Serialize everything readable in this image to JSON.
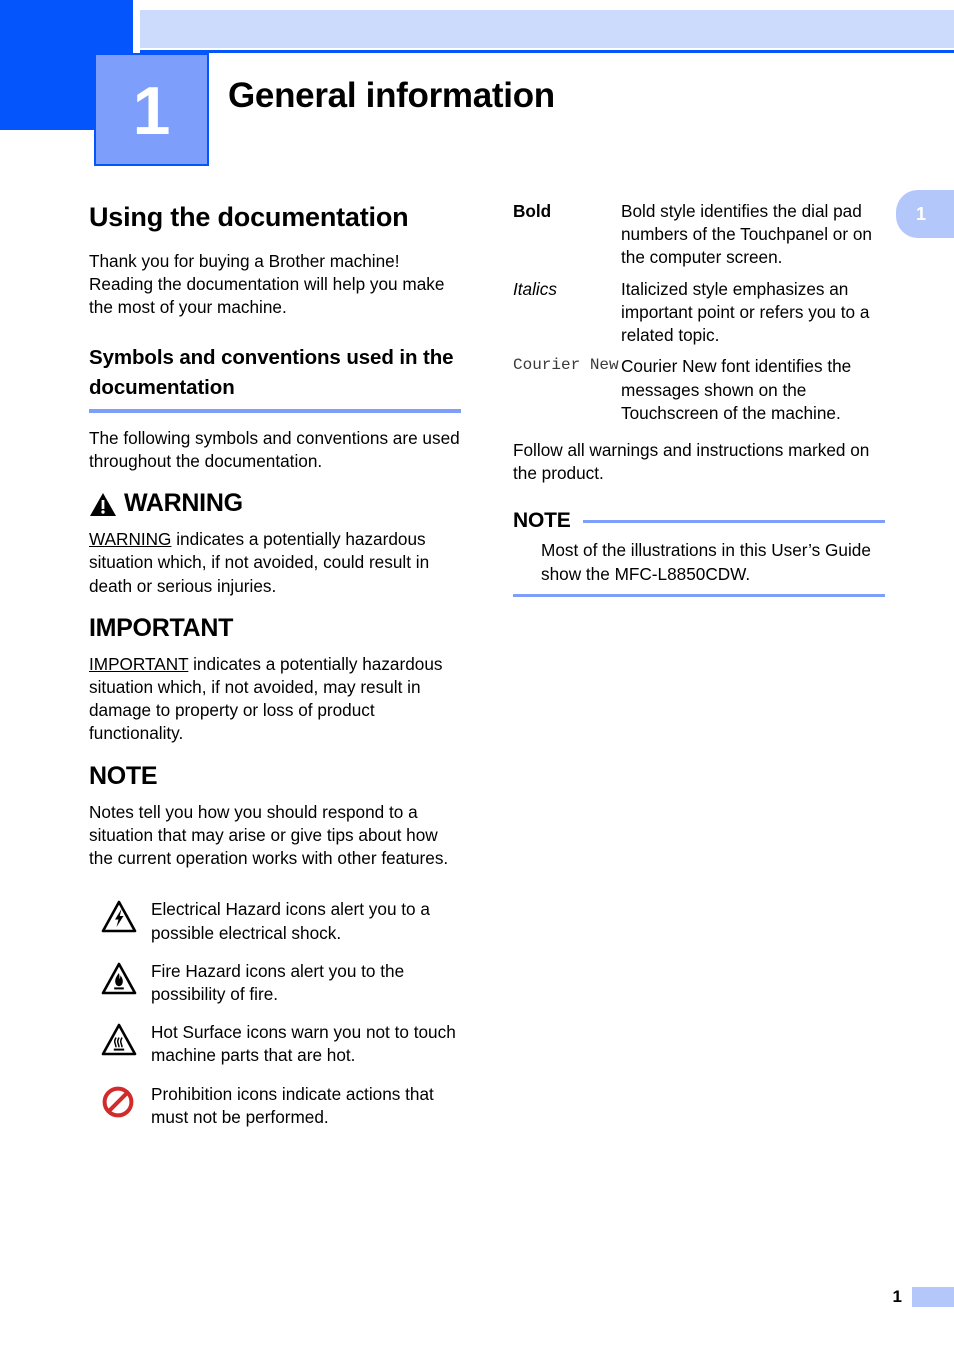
{
  "chapter": {
    "number": "1",
    "title": "General information",
    "side_tab_number": "1"
  },
  "left_column": {
    "section_title": "Using the documentation",
    "intro_paragraph": "Thank you for buying a Brother machine! Reading the documentation will help you make the most of your machine.",
    "subsection_title": "Symbols and conventions used in the documentation",
    "subsection_intro": "The following symbols and conventions are used throughout the documentation.",
    "alerts": [
      {
        "label": "WARNING",
        "has_triangle_icon": true,
        "lead_word": "WARNING",
        "body_rest": " indicates a potentially hazardous situation which, if not avoided, could result in death or serious injuries."
      },
      {
        "label": "IMPORTANT",
        "has_triangle_icon": false,
        "lead_word": "IMPORTANT",
        "body_rest": " indicates a potentially hazardous situation which, if not avoided, may result in damage to property or loss of product functionality."
      },
      {
        "label": "NOTE",
        "has_triangle_icon": false,
        "lead_word": "",
        "body_rest": "Notes tell you how you should respond to a situation that may arise or give tips about how the current operation works with other features."
      }
    ],
    "icon_list": [
      {
        "icon": "electrical-hazard-icon",
        "text": "Electrical Hazard icons alert you to a possible electrical shock."
      },
      {
        "icon": "fire-hazard-icon",
        "text": "Fire Hazard icons alert you to the possibility of fire."
      },
      {
        "icon": "hot-surface-icon",
        "text": "Hot Surface icons warn you not to touch machine parts that are hot."
      },
      {
        "icon": "prohibition-icon",
        "text": "Prohibition icons indicate actions that must not be performed."
      }
    ]
  },
  "right_column": {
    "style_table": [
      {
        "style": "Bold",
        "description": "Bold style identifies the dial pad numbers of the Touchpanel or on the computer screen."
      },
      {
        "style": "Italics",
        "description": "Italicized style emphasizes an important point or refers you to a related topic."
      },
      {
        "style": "Courier New",
        "description": "Courier New font identifies the messages shown on the Touchscreen of the machine."
      }
    ],
    "follow_paragraph": "Follow all warnings and instructions marked on the product.",
    "note_box": {
      "label": "NOTE",
      "text": "Most of the illustrations in this User’s Guide show the MFC-L8850CDW."
    }
  },
  "footer": {
    "page_number": "1"
  },
  "colors": {
    "deep_blue": "#0455fb",
    "light_blue_band": "#ccdafb",
    "medium_blue": "#7d9efb",
    "tab_blue": "#b3c7fb",
    "prohibition_red": "#d22b2b"
  }
}
